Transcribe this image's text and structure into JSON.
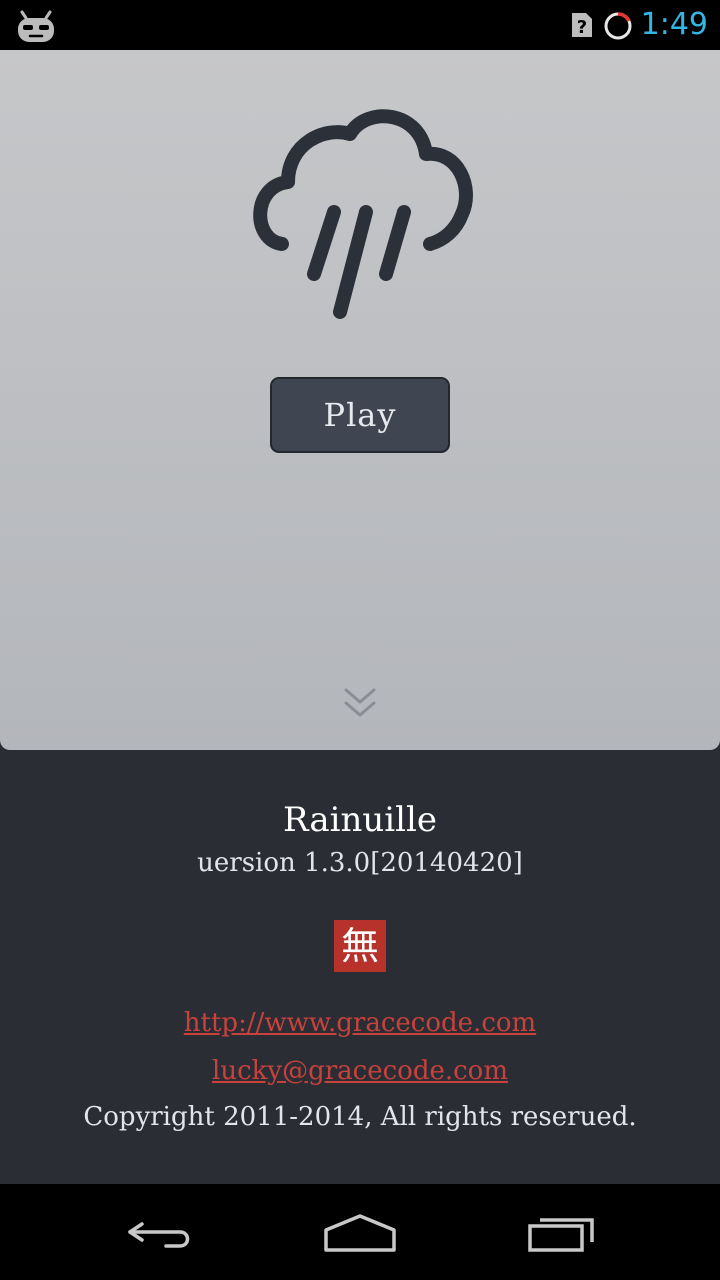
{
  "status_bar": {
    "time": "1:49",
    "time_color": "#33b5e5",
    "icons": [
      "cyanogenmod-icon",
      "sim-unknown-icon",
      "battery-charging-icon"
    ],
    "sim_glyph": "?"
  },
  "top_panel": {
    "icon": "cloud-rain-icon",
    "play_label": "Play",
    "expand_icon": "double-chevron-down-icon"
  },
  "about": {
    "app_name": "Rainuille",
    "version": "uersion 1.3.0[20140420]",
    "logo_glyph": "無",
    "logo_color": "#b8322c",
    "website": "http://www.gracecode.com",
    "email": "lucky@gracecode.com",
    "copyright": "Copyright 2011-2014, All rights reserued.",
    "link_color": "#c9413c"
  },
  "nav_bar": {
    "icons": [
      "back-icon",
      "home-icon",
      "recent-apps-icon"
    ]
  }
}
